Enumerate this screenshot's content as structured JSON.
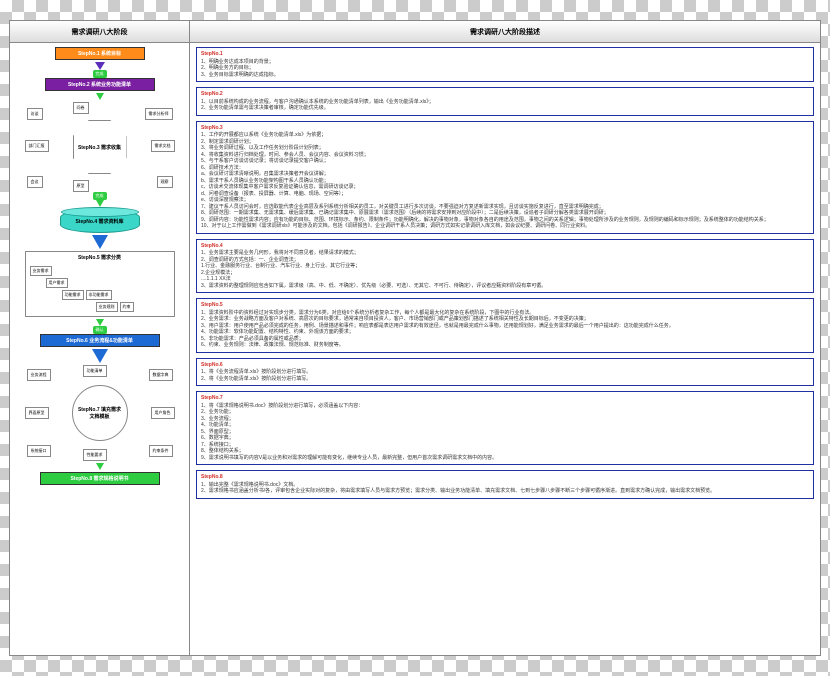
{
  "header": {
    "left": "需求调研八大阶段",
    "right": "需求调研八大阶段描述"
  },
  "steps": {
    "s1": "StepNo.1 系统目标",
    "s2": "StepNo.2 系统业务功能清单",
    "s3": "StepNo.3 需求收集",
    "s4": "StepNo.4 需求资料库",
    "s5": "StepNo.5 需求分类",
    "s6": "StepNo.6 业务流程&功能清单",
    "s7": "StepNo.7 填充需求文档模板",
    "s8": "StepNo.8 需求规格说明书"
  },
  "badges": {
    "wan": "完成",
    "que": "确认"
  },
  "inputs": {
    "i1": "部门汇报",
    "i2": "需求分析师",
    "i3": "需求文档",
    "i4": "访谈",
    "i5": "问卷",
    "i6": "会议",
    "i7": "原型",
    "i8": "观察"
  },
  "class": {
    "title": "StepNo.5 需求分类",
    "c1": "业务需求",
    "c2": "用户需求",
    "c3": "功能需求",
    "c4": "非功能需求",
    "c5": "业务规则",
    "c6": "约束"
  },
  "circ": {
    "t1": "业务流程",
    "t2": "功能清单",
    "t3": "数据字典",
    "t4": "界面原型",
    "t5": "用户角色",
    "t6": "系统接口",
    "t7": "性能要求",
    "t8": "约束条件"
  },
  "details": [
    {
      "t": "StepNo.1",
      "b": "1、明确业务达成本项目的背景；\n2、明确业务方的目标；\n3、业务目标需求明确的达成指标。"
    },
    {
      "t": "StepNo.2",
      "b": "1、以目前系统构成的业务流程，与客户沟通确认本系统的业务功能清单列表，输出《业务功能清单.xls》；\n2、业务功能清单需与需求决策者审核，确定功能优先级。"
    },
    {
      "t": "StepNo.3",
      "b": "1、工作的开展都应以系统《业务功能清单.xls》为依据；\n2、制定需求调研计划；\n3、将业务调研过程、以及工作任务划分阶段计划列表；\n4、将收集资料进行归档处理，时间、参会人员、会议内容、会议资料习惯；\n5、与干系客户访谈访谈记录；将访谈记录提交客户确认；\n6、调研技术方法：\n    a、会议研讨需求清晰说明，召集需求决策者开会议讲解；\n    b、需求干系人员确认业务功能架构图干系人员确认功能；\n    c、访谈术交流体现集中客户需求反复验证确认信息，需调研访谈记录；\n    d、问卷调查设备（报表、投屏器、计算、电脑、现场、空间等）；\n    e、访谈深度观察法；\n7、建议干系人员访问会时，应选取能代表企业高层及系列系统分析相关的员工，对关键员工进行多次访谈，不要强迫对方复述新需求实现，且访谈实施反复进行，直至需求明确完成；\n8、调研范围：一期需求集、无需求集、缓后需求集、已确记需求集中、原展需求（需求范围）（后续的将需求安排到对应阶段中）；二是后续决策，设追者子调研分解各类需求展开调研；\n9、调研内容：功能性需求内容；应有功能的目标、范围、环境标示、条约、限制条件；功能明确化，解决的事物对象，事物对象各自的用途及范围，事物之间的关系逻辑；事物处理所涉及的业务规则，及规则的编码和标示规则；及系统整体的功能结构关系；\n10、对于以上工作需做到《需求调研xls》可能涉及的文档，包括《调研报告》、企业调研干系人员决策；调研方式如实记录调研入库文档，如会议纪要、调研问卷、同行业资料。"
    },
    {
      "t": "StepNo.4",
      "b": "1、业务需求主要是业务几何形，我将对不同意见者，结果请求的模式；\n2、调查调研的方式包括：一、企业调查法；\n    1.行业、金融服务行业、台制行业、汽车行业、身上行业、其它行业等；\n    2.企业规模法；\n    ....1.1.1 XX法\n3、需求资料的整理规则应包含如下属，需求级（高、中、低、不确定）、优先级（必要、可选）、无其它、不可行、待确定），评议者应甄资料阶段有章可循。"
    },
    {
      "t": "StepNo.5",
      "b": "1、需求资料阶中的资料经过对实现步分类，需求分为6类，对应给6个系统分析者复杂工作，每个人都是最大化的复杂在系统阶段，下图中的行业有法。\n2、业务需求：业务战略方面及客户对系统、高层次的目标要求，通常来自项目投资人，客户、市场营销部门或产品策划部门描述了系统相关特性及长期目标后，不变更的决策；\n3、用户需求：用户使用产品必须完成的任务，用例、场景描述和事件；响应表都是表达用户需求的有效途径，也就是用最完成什么事物，还用能规划好，满足业务需求的最后一个用户提出的：这功能完成什么任务。\n4、功能需求：软体功能配置、结构特性、约束、外观该方面的要求；\n5、非功能需求：产品必须具备的属性或品质；\n6、约束、业务规则：法律、政策法规、规范标准、财务制度等。"
    },
    {
      "t": "StepNo.6",
      "b": "1、将《业务流程清单.xls》按阶段划分进行填写。\n2、将《业务功能清单.xls》按阶段划分进行填写。"
    },
    {
      "t": "StepNo.7",
      "b": "1、将《需求规格说明书.doc》按阶段划分进行填写，必须涵盖以下内容：\n2、业务功能；\n3、业务流程；\n4、功能清单；\n5、界面原型；\n6、数据字典；\n7、系统接口；\n8、整体结构关系；\n9、需求说明书填写的内容V是以业务和对需求的理解可能有变化，继续专业人员，最新完整，但用户首次需求调研需求文档中的内容。"
    },
    {
      "t": "StepNo.8",
      "b": "1、输出完整《需求规格说明书.doc》文档。\n2、需求规格书应涵盖分析书/各，评审包含企业实际对的复杂，将由需求填写人员与需求方预览；需求分类、输出业务功能清单、填充需求文档、七到七步骤八步骤不断三个步骤可循序渐进。直到需求方确认完成，输出需求文档预览。"
    }
  ]
}
